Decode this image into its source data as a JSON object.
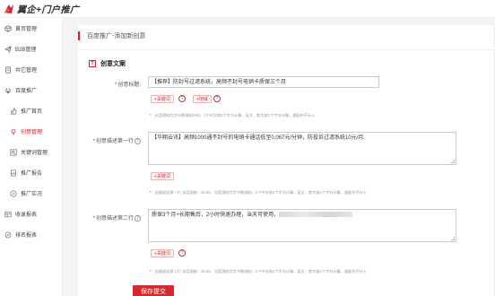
{
  "brand": {
    "name": "翼企+门户推广"
  },
  "sidebar": {
    "items": [
      {
        "label": "黄页管理",
        "icon": "cube-icon",
        "sub": false,
        "active": false
      },
      {
        "label": "B2B管理",
        "icon": "send-icon",
        "sub": false,
        "active": false
      },
      {
        "label": "共它管理",
        "icon": "doc-icon",
        "sub": false,
        "active": false
      },
      {
        "label": "百度推广",
        "icon": "paw-icon",
        "sub": false,
        "active": false
      },
      {
        "label": "推广首页",
        "icon": "thumb-icon",
        "sub": true,
        "active": false
      },
      {
        "label": "创意管理",
        "icon": "bulb-icon",
        "sub": true,
        "active": true
      },
      {
        "label": "关键词管理",
        "icon": "search-icon",
        "sub": true,
        "active": false
      },
      {
        "label": "推广报告",
        "icon": "report-icon",
        "sub": true,
        "active": false
      },
      {
        "label": "推广实况",
        "icon": "compass-icon",
        "sub": true,
        "active": false
      },
      {
        "label": "收录报表",
        "icon": "table-icon",
        "sub": false,
        "active": false
      },
      {
        "label": "排名报表",
        "icon": "rank-icon",
        "sub": false,
        "active": false
      }
    ]
  },
  "breadcrumb": "百度推广-添加新创意",
  "section": {
    "badge": "T",
    "title": "创意文案"
  },
  "form": {
    "title": {
      "label": "创意标题:",
      "value": "【推荐】防封号过滤系统，高频不封号电销卡质保三个月",
      "kw_btn1": "+关键词",
      "kw_btn2": "+地域",
      "hint": "长度限制为字节数限制9-50，1个中文按2个字节计算，英文、数字按1个字节计算，通配符不计入"
    },
    "line1": {
      "label": "创意描述第一行",
      "value": "【华翔云讯】高频1000通不封号的电销卡通话低至0.067元/分钟，防投诉过滤系统10元/月.",
      "kw_btn": "+关键词",
      "hint": "创意描述第一行 长度限制：29,80，长度限制为字节数限制，1个中文按2个字节计算，英文、数字按1个字节计算，通配符不计入"
    },
    "line2": {
      "label": "创意描述第二行",
      "value": "质保3个月+长期售后，2小时快速办理，当天可使用，",
      "kw_btn": "+关键词",
      "hint": "创意描述第二行 长度限制：29,80，长度限制为字节数限制，1个中文按2个字节计算，英文、数字按1个字节计算，通配符不计入"
    },
    "save_label": "保存提交"
  },
  "colors": {
    "accent": "#d3202a",
    "button": "#d9272d"
  }
}
